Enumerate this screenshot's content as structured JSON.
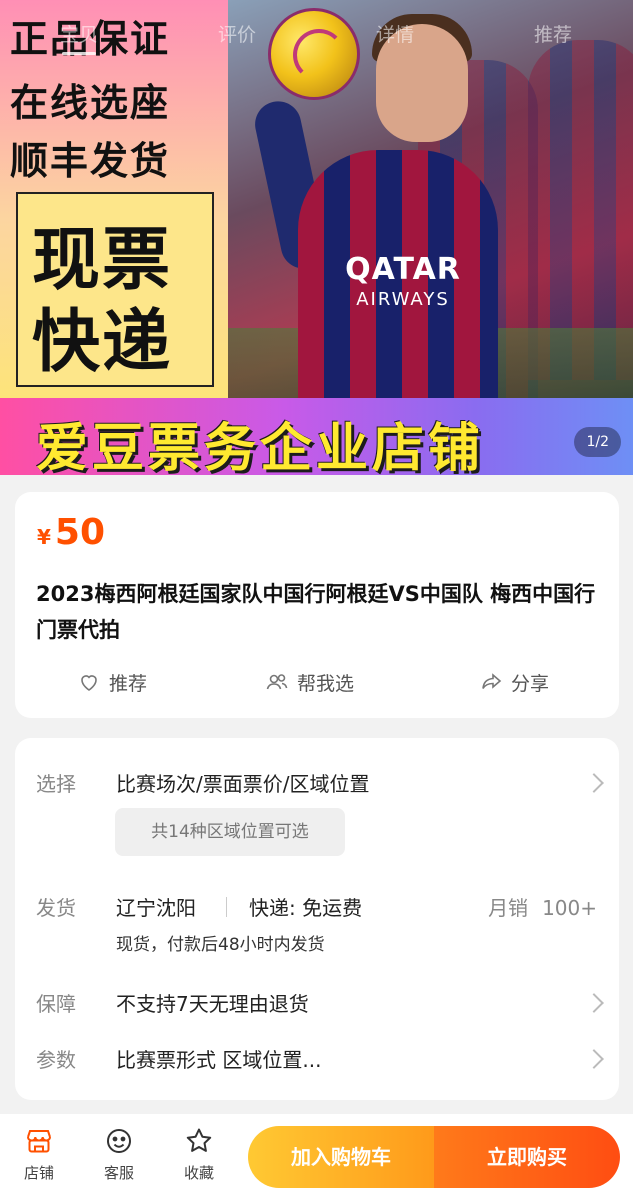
{
  "nav": {
    "tabs": [
      {
        "label": "宝贝"
      },
      {
        "label": "评价"
      },
      {
        "label": "详情"
      },
      {
        "label": "推荐"
      }
    ]
  },
  "hero": {
    "promo_lines": [
      "正品保证",
      "在线选座",
      "顺丰发货"
    ],
    "promo_box": [
      "现票",
      "快递"
    ],
    "jersey_text": "QATAR",
    "jersey_sub": "AIRWAYS",
    "banner": "爱豆票务企业店铺",
    "pager": "1/2"
  },
  "product": {
    "currency": "¥",
    "price": "50",
    "title": "2023梅西阿根廷国家队中国行阿根廷VS中国队 梅西中国行门票代拍",
    "actions": {
      "recommend": "推荐",
      "help_choose": "帮我选",
      "share": "分享"
    }
  },
  "details": {
    "select": {
      "label": "选择",
      "value": "比赛场次/票面票价/区域位置",
      "chip": "共14种区域位置可选"
    },
    "shipping": {
      "label": "发货",
      "origin": "辽宁沈阳",
      "express": "快递: 免运费",
      "sales_label": "月销",
      "sales_value": "100+",
      "note": "现货，付款后48小时内发货"
    },
    "guarantee": {
      "label": "保障",
      "value": "不支持7天无理由退货"
    },
    "params": {
      "label": "参数",
      "value": "比赛票形式 区域位置..."
    }
  },
  "bottom_bar": {
    "shop": "店铺",
    "service": "客服",
    "favorite": "收藏",
    "add_to_cart": "加入购物车",
    "buy_now": "立即购买"
  },
  "colors": {
    "price": "#ff5000",
    "cart_button": "#ffb020",
    "buy_button": "#ff5a14",
    "banner_text": "#ffe930"
  }
}
